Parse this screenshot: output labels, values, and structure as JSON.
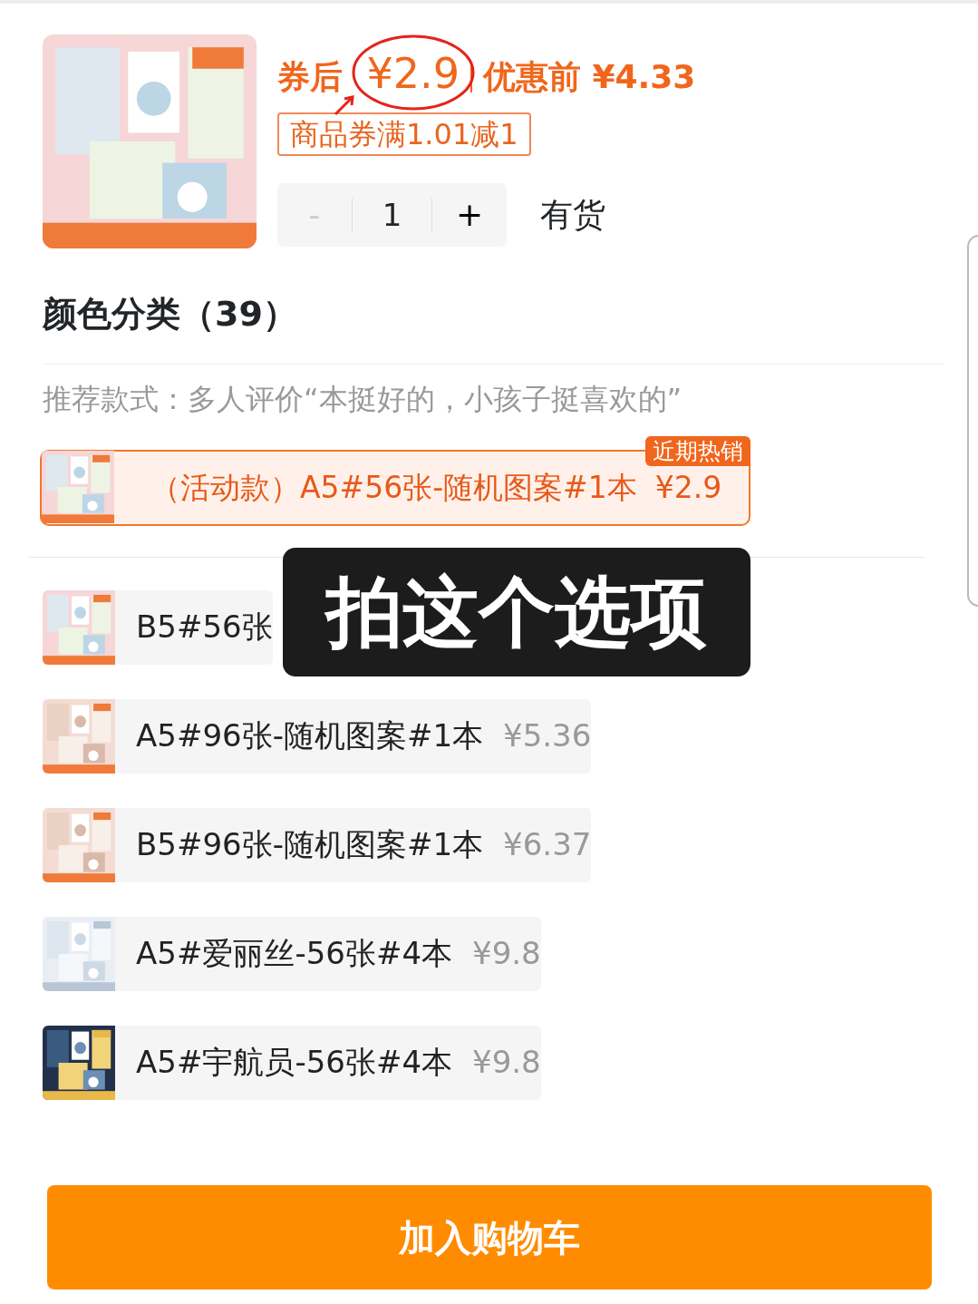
{
  "product": {
    "price_label": "券后",
    "price": "¥2.9",
    "original_price": "优惠前 ¥4.33",
    "coupon": "商品券满1.01减1"
  },
  "quantity": {
    "minus": "-",
    "value": "1",
    "plus": "+",
    "minus_disabled": true
  },
  "stock": "有货",
  "section_title": "颜色分类（39）",
  "recommend": "推荐款式：多人评价“本挺好的，小孩子挺喜欢的”",
  "featured_option": {
    "label": "（活动款）A5#56张-随机图案#1本",
    "price": "¥2.9",
    "badge": "近期热销",
    "selected": true
  },
  "options": [
    {
      "label": "B5#56张",
      "selected": false
    },
    {
      "label": "A5#96张-随机图案#1本",
      "price": "¥5.36",
      "selected": false
    },
    {
      "label": "B5#96张-随机图案#1本",
      "price": "¥6.37",
      "selected": false
    },
    {
      "label": "A5#爱丽丝-56张#4本",
      "price": "¥9.8",
      "selected": false
    },
    {
      "label": "A5#宇航员-56张#4本",
      "price": "¥9.8",
      "selected": false
    }
  ],
  "overlay_caption": "拍这个选项",
  "cart_button": "加入购物车"
}
